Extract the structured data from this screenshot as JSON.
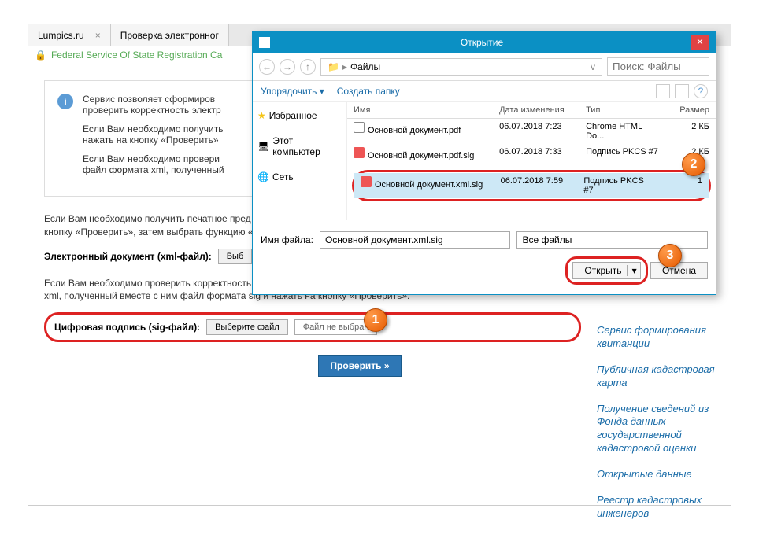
{
  "browser": {
    "tabs": [
      {
        "title": "Lumpics.ru"
      },
      {
        "title": "Проверка электронног"
      }
    ],
    "url": "Federal Service Of State Registration Ca"
  },
  "page": {
    "info": {
      "p1": "Сервис позволяет сформиров",
      "p2": "проверить корректность электр",
      "p3": "Если Вам необходимо получить",
      "p4": "нажать на кнопку «Проверить»",
      "p5": "Если Вам необходимо провери",
      "p6": "файл формата xml, полученный"
    },
    "para1": "Если Вам необходимо получить печатное пред",
    "para1b": "кнопку «Проверить», затем выбрать функцию «П",
    "xml_label": "Электронный документ (xml-файл):",
    "xml_btn": "Выб",
    "para2": "Если Вам необходимо проверить корректность электронной цифровой подписи, необходимо прикрепить файл формата xml, полученный вместе с ним файл формата sig и нажать на кнопку «Проверить».",
    "sig_label": "Цифровая подпись (sig-файл):",
    "choose_btn": "Выберите файл",
    "file_status": "Файл не выбран",
    "check_btn": "Проверить »"
  },
  "sidebar": {
    "links": [
      "Сервис формирования квитанции",
      "Публичная кадастровая карта",
      "Получение сведений из Фонда данных государственной кадастровой оценки",
      "Открытые данные",
      "Реестр кадастровых инженеров"
    ]
  },
  "dialog": {
    "title": "Открытие",
    "path_folder": "Файлы",
    "search_ph": "Поиск: Файлы",
    "organize": "Упорядочить ▾",
    "new_folder": "Создать папку",
    "tree": {
      "fav": "Избранное",
      "computer": "Этот компьютер",
      "network": "Сеть"
    },
    "columns": {
      "name": "Имя",
      "date": "Дата изменения",
      "type": "Тип",
      "size": "Размер"
    },
    "files": [
      {
        "name": "Основной документ.pdf",
        "date": "06.07.2018 7:23",
        "type": "Chrome HTML Do...",
        "size": "2 КБ"
      },
      {
        "name": "Основной документ.pdf.sig",
        "date": "06.07.2018 7:33",
        "type": "Подпись PKCS #7",
        "size": "2 КБ"
      },
      {
        "name": "Основной документ.xml.sig",
        "date": "06.07.2018 7:59",
        "type": "Подпись PKCS #7",
        "size": "1"
      }
    ],
    "fname_label": "Имя файла:",
    "fname_value": "Основной документ.xml.sig",
    "filetype": "Все файлы",
    "open_btn": "Открыть",
    "cancel_btn": "Отмена"
  },
  "callouts": {
    "c1": "1",
    "c2": "2",
    "c3": "3"
  }
}
